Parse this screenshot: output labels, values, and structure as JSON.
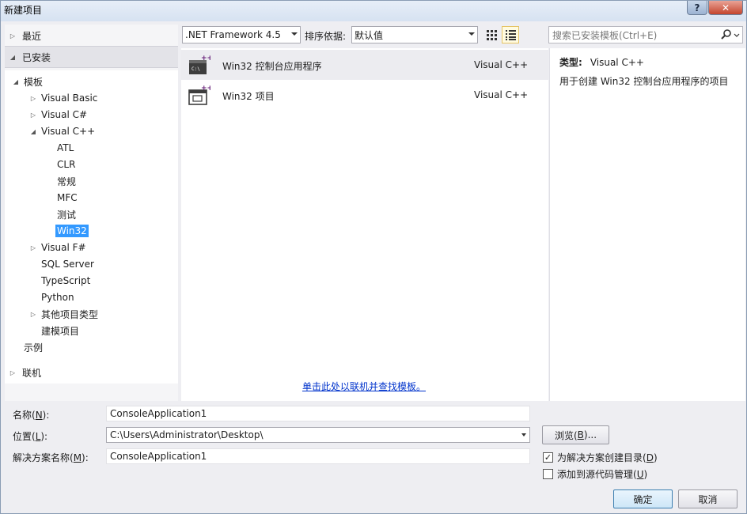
{
  "window": {
    "title": "新建项目"
  },
  "titlebar": {
    "help_glyph": "?",
    "close_glyph": "✕"
  },
  "tree": {
    "recent": "最近",
    "installed": "已安装",
    "templates": "模板",
    "items": [
      {
        "label": "Visual Basic",
        "expandable": true
      },
      {
        "label": "Visual C#",
        "expandable": true
      },
      {
        "label": "Visual C++",
        "expandable": true,
        "expanded": true
      },
      {
        "label": "ATL"
      },
      {
        "label": "CLR"
      },
      {
        "label": "常规"
      },
      {
        "label": "MFC"
      },
      {
        "label": "测试"
      },
      {
        "label": "Win32",
        "selected": true
      },
      {
        "label": "Visual F#",
        "expandable": true
      },
      {
        "label": "SQL Server"
      },
      {
        "label": "TypeScript"
      },
      {
        "label": "Python"
      },
      {
        "label": "其他项目类型",
        "expandable": true
      },
      {
        "label": "建模项目"
      }
    ],
    "samples": "示例",
    "online": "联机"
  },
  "toolbar": {
    "framework": ".NET Framework 4.5",
    "sort_label": "排序依据:",
    "sort_value": "默认值",
    "search_placeholder": "搜索已安装模板(Ctrl+E)"
  },
  "templates": [
    {
      "name": "Win32 控制台应用程序",
      "lang": "Visual C++",
      "selected": true,
      "icon": "console-app-icon"
    },
    {
      "name": "Win32 项目",
      "lang": "Visual C++",
      "selected": false,
      "icon": "win32-project-icon"
    }
  ],
  "online_link": "单击此处以联机并查找模板。",
  "description": {
    "type_label": "类型:",
    "type_value": "Visual C++",
    "text": "用于创建 Win32 控制台应用程序的项目"
  },
  "form": {
    "name_label": "名称(",
    "name_key": "N",
    "name_label_end": "):",
    "name_value": "ConsoleApplication1",
    "location_label": "位置(",
    "location_key": "L",
    "location_label_end": "):",
    "location_value": "C:\\Users\\Administrator\\Desktop\\",
    "solution_label": "解决方案名称(",
    "solution_key": "M",
    "solution_label_end": "):",
    "solution_value": "ConsoleApplication1",
    "browse": "浏览(",
    "browse_key": "B",
    "browse_end": ")...",
    "create_dir": "为解决方案创建目录(",
    "create_dir_key": "D",
    "create_dir_end": ")",
    "create_dir_checked": true,
    "source_control": "添加到源代码管理(",
    "source_control_key": "U",
    "source_control_end": ")",
    "source_control_checked": false,
    "ok": "确定",
    "cancel": "取消"
  }
}
